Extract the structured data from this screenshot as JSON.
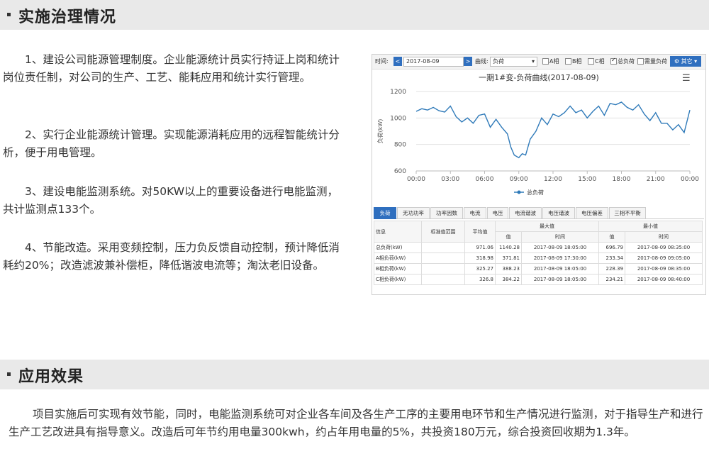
{
  "section1": {
    "title": "实施治理情况"
  },
  "paragraphs": [
    "1、建设公司能源管理制度。企业能源统计员实行持证上岗和统计岗位责任制，对公司的生产、工艺、能耗应用和统计实行管理。",
    "2、实行企业能源统计管理。实现能源消耗应用的远程智能统计分析，便于用电管理。",
    "3、建设电能监测系统。对50KW以上的重要设备进行电能监测，共计监测点133个。",
    "4、节能改造。采用变频控制，压力负反馈自动控制，预计降低消耗约20%；改造滤波兼补偿柜，降低谐波电流等；淘汰老旧设备。"
  ],
  "section2": {
    "title": "应用效果"
  },
  "result_text": "项目实施后可实现有效节能，同时，电能监测系统可对企业各车间及各生产工序的主要用电环节和生产情况进行监测，对于指导生产和进行生产工艺改进具有指导意义。改造后可年节约用电量300kwh，约占年用电量的5%，共投资180万元，综合投资回收期为1.3年。",
  "toolbar": {
    "time_label": "时间:",
    "prev": "<",
    "next": ">",
    "date": "2017-08-09",
    "curve_label": "曲线:",
    "curve_value": "负荷",
    "checkboxes": [
      {
        "label": "A相",
        "checked": false
      },
      {
        "label": "B相",
        "checked": false
      },
      {
        "label": "C相",
        "checked": false
      },
      {
        "label": "总负荷",
        "checked": true
      },
      {
        "label": "需量负荷",
        "checked": false
      }
    ],
    "more": "其它"
  },
  "chart_data": {
    "type": "line",
    "title": "一期1#变-负荷曲线(2017-08-09)",
    "ylabel": "负荷(kW)",
    "xlabel": "",
    "ylim": [
      600,
      1200
    ],
    "yticks": [
      "600",
      "800",
      "1000",
      "1200"
    ],
    "xticks": [
      "00:00",
      "03:00",
      "06:00",
      "09:00",
      "12:00",
      "15:00",
      "18:00",
      "21:00",
      "00:00"
    ],
    "grid": true,
    "legend": "bottom",
    "color": "#2f7ab9",
    "series": [
      {
        "name": "总负荷",
        "x_hours": [
          0,
          0.5,
          1,
          1.5,
          2,
          2.5,
          3,
          3.5,
          4,
          4.5,
          5,
          5.5,
          6,
          6.5,
          7,
          7.5,
          8,
          8.3,
          8.6,
          9,
          9.3,
          9.6,
          10,
          10.5,
          11,
          11.5,
          12,
          12.5,
          13,
          13.5,
          14,
          14.5,
          15,
          15.5,
          16,
          16.5,
          17,
          17.5,
          18,
          18.5,
          19,
          19.5,
          20,
          20.5,
          21,
          21.5,
          22,
          22.5,
          23,
          23.5,
          24
        ],
        "values": [
          1050,
          1070,
          1060,
          1080,
          1055,
          1045,
          1090,
          1010,
          970,
          1000,
          960,
          1020,
          1030,
          930,
          990,
          930,
          880,
          780,
          720,
          700,
          730,
          720,
          840,
          900,
          1000,
          950,
          1030,
          1010,
          1040,
          1090,
          1040,
          1060,
          1000,
          1050,
          1090,
          1020,
          1110,
          1100,
          1120,
          1080,
          1060,
          1100,
          1030,
          980,
          1040,
          960,
          960,
          910,
          950,
          890,
          1060
        ]
      }
    ]
  },
  "tabs": [
    "负荷",
    "无功功率",
    "功率因数",
    "电流",
    "电压",
    "电流谐波",
    "电压谐波",
    "电压偏差",
    "三相不平衡"
  ],
  "table": {
    "headers": {
      "info": "信息",
      "std": "标准值范围",
      "avg": "平均值",
      "max": "最大值",
      "min": "最小值",
      "value": "值",
      "time": "时间"
    },
    "rows": [
      {
        "name": "总负荷(kW)",
        "std": "",
        "avg": "971.06",
        "max": "1140.28",
        "max_time": "2017-08-09 18:05:00",
        "min": "696.79",
        "min_time": "2017-08-09 08:35:00"
      },
      {
        "name": "A相负荷(kW)",
        "std": "",
        "avg": "318.98",
        "max": "371.81",
        "max_time": "2017-08-09 17:30:00",
        "min": "233.34",
        "min_time": "2017-08-09 09:05:00"
      },
      {
        "name": "B相负荷(kW)",
        "std": "",
        "avg": "325.27",
        "max": "388.23",
        "max_time": "2017-08-09 18:05:00",
        "min": "228.39",
        "min_time": "2017-08-09 08:35:00"
      },
      {
        "name": "C相负荷(kW)",
        "std": "",
        "avg": "326.8",
        "max": "384.22",
        "max_time": "2017-08-09 18:05:00",
        "min": "234.21",
        "min_time": "2017-08-09 08:40:00"
      }
    ]
  }
}
